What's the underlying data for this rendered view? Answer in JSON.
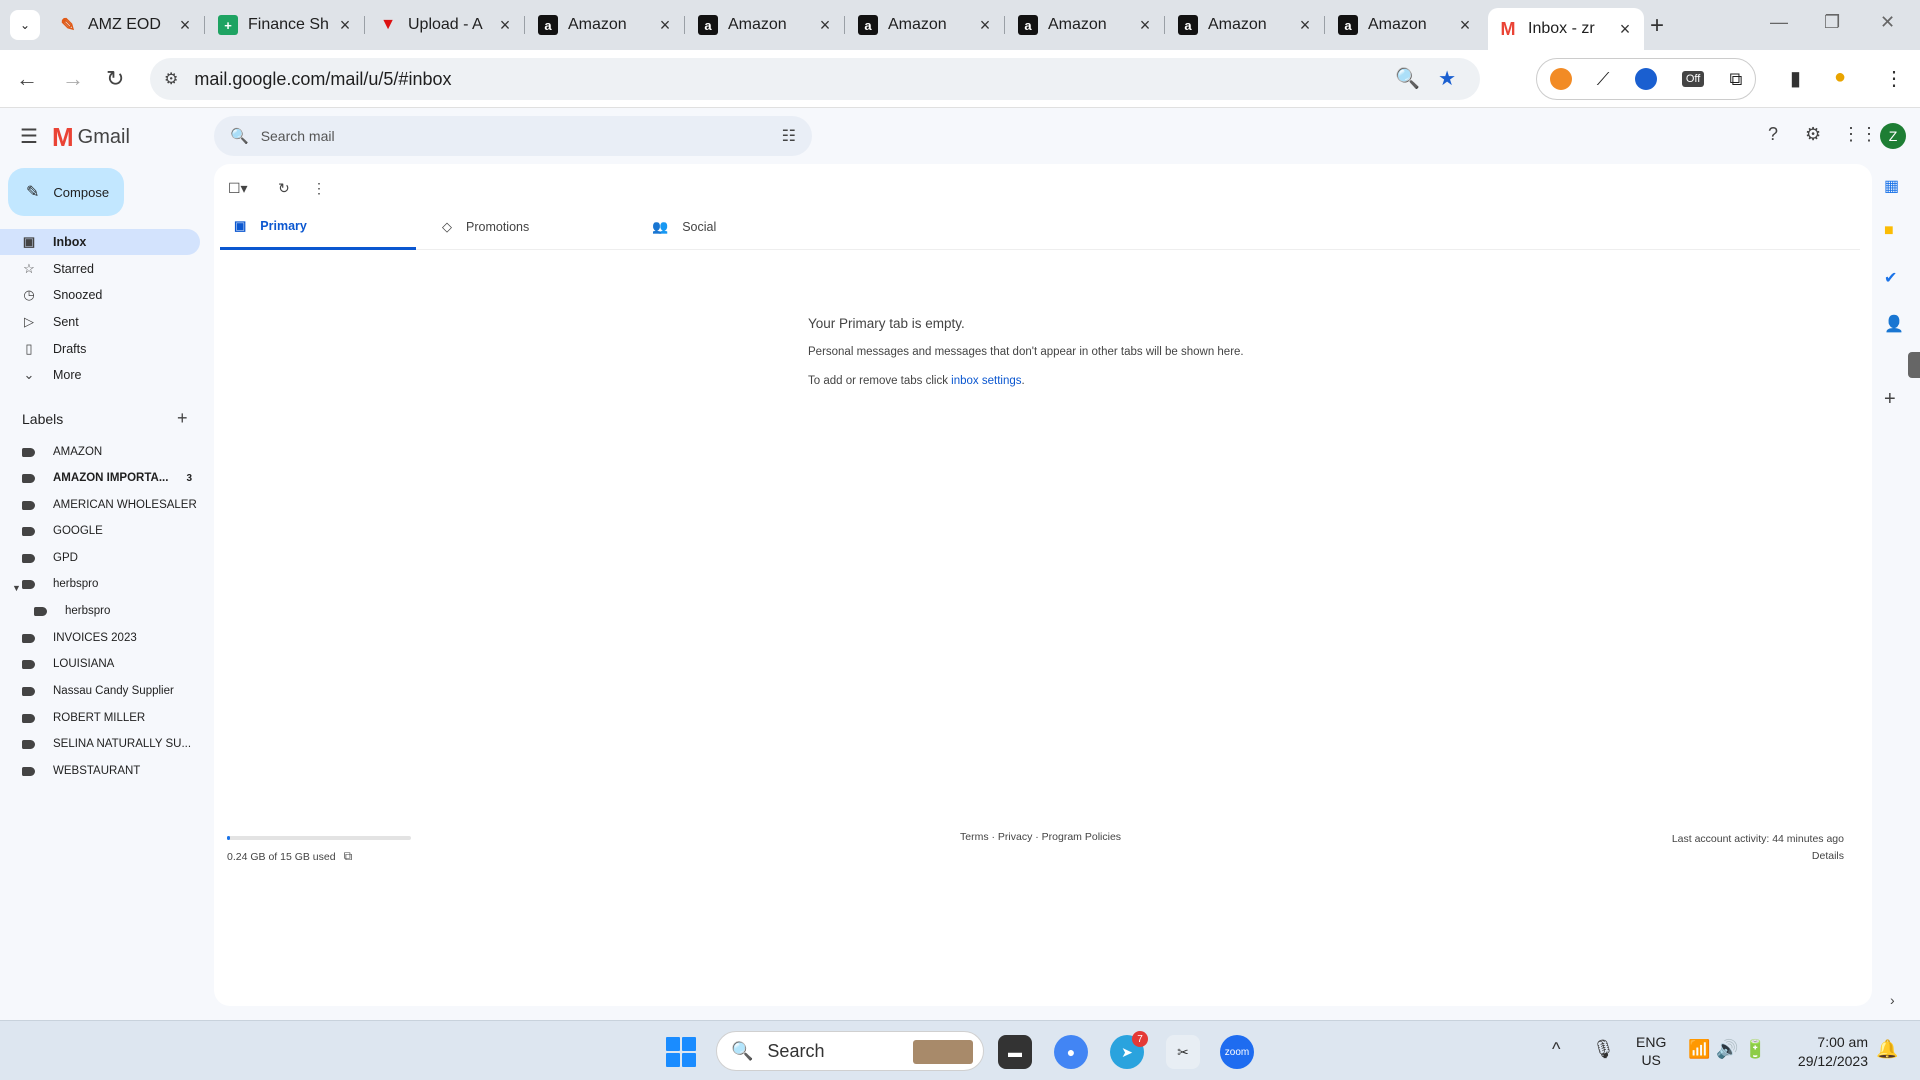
{
  "browser": {
    "tabs": [
      {
        "title": "AMZ EOD",
        "favicon": "amz-eod-icon"
      },
      {
        "title": "Finance Sh",
        "favicon": "sheets-icon"
      },
      {
        "title": "Upload - A",
        "favicon": "upload-icon"
      },
      {
        "title": "Amazon",
        "favicon": "amazon-icon"
      },
      {
        "title": "Amazon",
        "favicon": "amazon-icon"
      },
      {
        "title": "Amazon",
        "favicon": "amazon-icon"
      },
      {
        "title": "Amazon",
        "favicon": "amazon-icon"
      },
      {
        "title": "Amazon",
        "favicon": "amazon-icon"
      },
      {
        "title": "Amazon",
        "favicon": "amazon-icon"
      },
      {
        "title": "Inbox - zr",
        "favicon": "gmail-icon",
        "active": true
      }
    ],
    "url": "mail.google.com/mail/u/5/#inbox",
    "extension_badge": "Off"
  },
  "gmail": {
    "app_name": "Gmail",
    "search_placeholder": "Search mail",
    "avatar_letter": "Z",
    "compose_label": "Compose",
    "nav": [
      {
        "label": "Inbox",
        "icon": "inbox-icon",
        "active": true
      },
      {
        "label": "Starred",
        "icon": "star-icon"
      },
      {
        "label": "Snoozed",
        "icon": "clock-icon"
      },
      {
        "label": "Sent",
        "icon": "send-icon"
      },
      {
        "label": "Drafts",
        "icon": "draft-icon"
      },
      {
        "label": "More",
        "icon": "chevron-down-icon"
      }
    ],
    "labels_heading": "Labels",
    "labels": [
      {
        "name": "AMAZON"
      },
      {
        "name": "AMAZON IMPORTA...",
        "count": "3",
        "bold": true
      },
      {
        "name": "AMERICAN WHOLESALER"
      },
      {
        "name": "GOOGLE"
      },
      {
        "name": "GPD"
      },
      {
        "name": "herbspro",
        "expanded": true
      },
      {
        "name": "herbspro",
        "child": true
      },
      {
        "name": "INVOICES 2023"
      },
      {
        "name": "LOUISIANA"
      },
      {
        "name": "Nassau Candy Supplier"
      },
      {
        "name": "ROBERT MILLER"
      },
      {
        "name": "SELINA NATURALLY SU..."
      },
      {
        "name": "WEBSTAURANT"
      }
    ],
    "tabs": [
      {
        "label": "Primary",
        "icon": "inbox-tab-icon",
        "active": true
      },
      {
        "label": "Promotions",
        "icon": "tag-icon"
      },
      {
        "label": "Social",
        "icon": "people-icon"
      }
    ],
    "empty": {
      "title": "Your Primary tab is empty.",
      "line1": "Personal messages and messages that don't appear in other tabs will be shown here.",
      "line2_prefix": "To add or remove tabs click ",
      "line2_link": "inbox settings",
      "line2_suffix": "."
    },
    "storage": {
      "text": "0.24 GB of 15 GB used",
      "used_fraction": 0.016
    },
    "footer_links": "Terms · Privacy · Program Policies",
    "activity": {
      "line1": "Last account activity: 44 minutes ago",
      "details": "Details"
    }
  },
  "taskbar": {
    "search_label": "Search",
    "telegram_badge": "7",
    "lang_line1": "ENG",
    "lang_line2": "US",
    "time": "7:00 am",
    "date": "29/12/2023"
  },
  "colors": {
    "accent": "#0b57d0",
    "compose_bg": "#c2e7ff",
    "active_nav_bg": "#d3e3fd"
  }
}
